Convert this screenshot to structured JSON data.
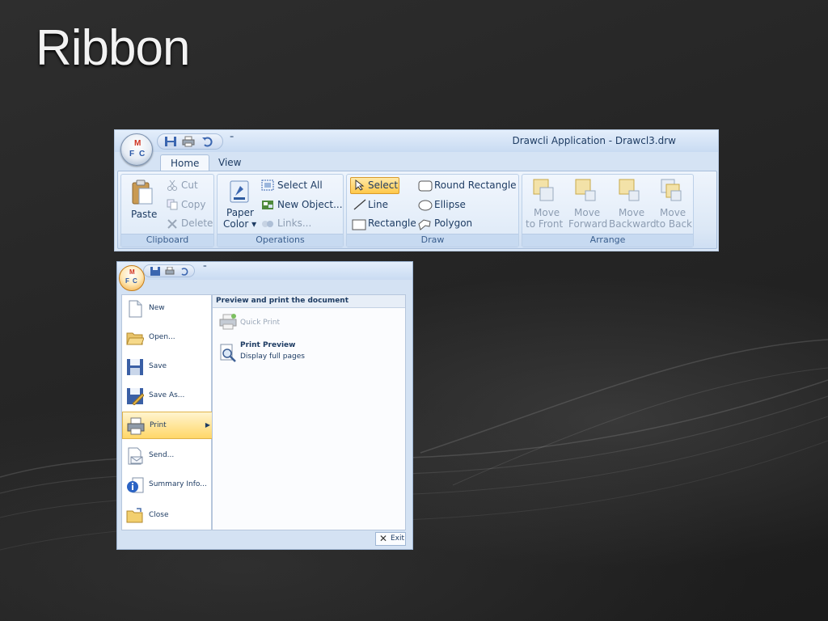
{
  "slide": {
    "title": "Ribbon"
  },
  "ribbon_window": {
    "title": "Drawcli Application - Drawcl3.drw",
    "orb_letters": [
      "M",
      "F",
      "C"
    ],
    "qat_more": "⁼",
    "tabs": [
      {
        "label": "Home",
        "active": true
      },
      {
        "label": "View",
        "active": false
      }
    ],
    "groups": {
      "clipboard": {
        "label": "Clipboard",
        "paste": "Paste",
        "cut": "Cut",
        "copy": "Copy",
        "delete": "Delete"
      },
      "operations": {
        "label": "Operations",
        "paper_color_line1": "Paper",
        "paper_color_line2": "Color",
        "select_all": "Select All",
        "new_object": "New Object...",
        "links": "Links..."
      },
      "draw": {
        "label": "Draw",
        "select": "Select",
        "line": "Line",
        "rectangle": "Rectangle",
        "round_rectangle": "Round Rectangle",
        "ellipse": "Ellipse",
        "polygon": "Polygon"
      },
      "arrange": {
        "label": "Arrange",
        "buttons": [
          {
            "line1": "Move",
            "line2": "to Front"
          },
          {
            "line1": "Move",
            "line2": "Forward"
          },
          {
            "line1": "Move",
            "line2": "Backward"
          },
          {
            "line1": "Move",
            "line2": "to Back"
          }
        ]
      }
    }
  },
  "menu_window": {
    "orb_letters": [
      "M",
      "F",
      "C"
    ],
    "qat_more": "⁼",
    "items": [
      {
        "label": "New",
        "icon": "new-document-icon"
      },
      {
        "label": "Open...",
        "icon": "open-folder-icon"
      },
      {
        "label": "Save",
        "icon": "save-icon"
      },
      {
        "label": "Save As...",
        "icon": "save-as-icon"
      },
      {
        "label": "Print",
        "icon": "print-icon",
        "selected": true
      },
      {
        "label": "Send...",
        "icon": "send-icon"
      },
      {
        "label": "Summary Info...",
        "icon": "summary-info-icon"
      },
      {
        "label": "Close",
        "icon": "close-folder-icon"
      }
    ],
    "submenu": {
      "heading": "Preview and print the document",
      "quick_print": "Quick Print",
      "print_preview": "Print Preview",
      "print_preview_desc": "Display full pages"
    },
    "exit_label": "Exit"
  },
  "colors": {
    "ribbon_bg": "#dbe8f7",
    "selected_item": "#ffd768",
    "select_tool": "#ffc84a"
  }
}
